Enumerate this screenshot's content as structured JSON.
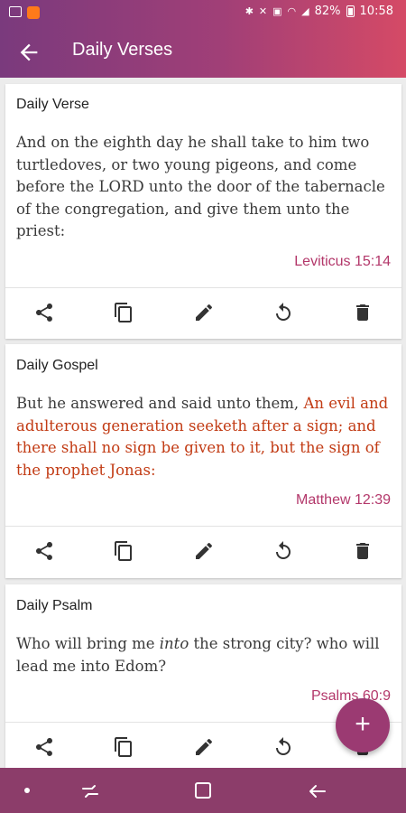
{
  "status_bar": {
    "battery": "82%",
    "time": "10:58"
  },
  "app_bar": {
    "title": "Daily Verses"
  },
  "cards": [
    {
      "title": "Daily Verse",
      "text_segments": [
        {
          "text": "And on the eighth day he shall take to him two turtledoves, or two young pigeons, and come before the LORD unto the door of the tabernacle of the congregation, and give them unto the priest:",
          "style": "normal"
        }
      ],
      "reference": "Leviticus 15:14"
    },
    {
      "title": "Daily Gospel",
      "text_segments": [
        {
          "text": "But he answered and said unto them, ",
          "style": "normal"
        },
        {
          "text": "An evil and adulterous generation seeketh after a sign; and there shall no sign be given to it, but the sign of the prophet Jonas:",
          "style": "red"
        }
      ],
      "reference": "Matthew 12:39"
    },
    {
      "title": "Daily Psalm",
      "text_segments": [
        {
          "text": "Who will bring me ",
          "style": "normal"
        },
        {
          "text": "into",
          "style": "italic"
        },
        {
          "text": " the strong city? who will lead me into Edom?",
          "style": "normal"
        }
      ],
      "reference": "Psalms 60:9"
    }
  ],
  "card_actions": [
    "share-icon",
    "copy-icon",
    "edit-icon",
    "refresh-icon",
    "delete-icon"
  ],
  "fab": {
    "label": "+"
  },
  "colors": {
    "accent": "#9b3a72",
    "reference": "#b3376a",
    "red_letters": "#c23b14",
    "nav_bar": "#8c3d6a"
  }
}
